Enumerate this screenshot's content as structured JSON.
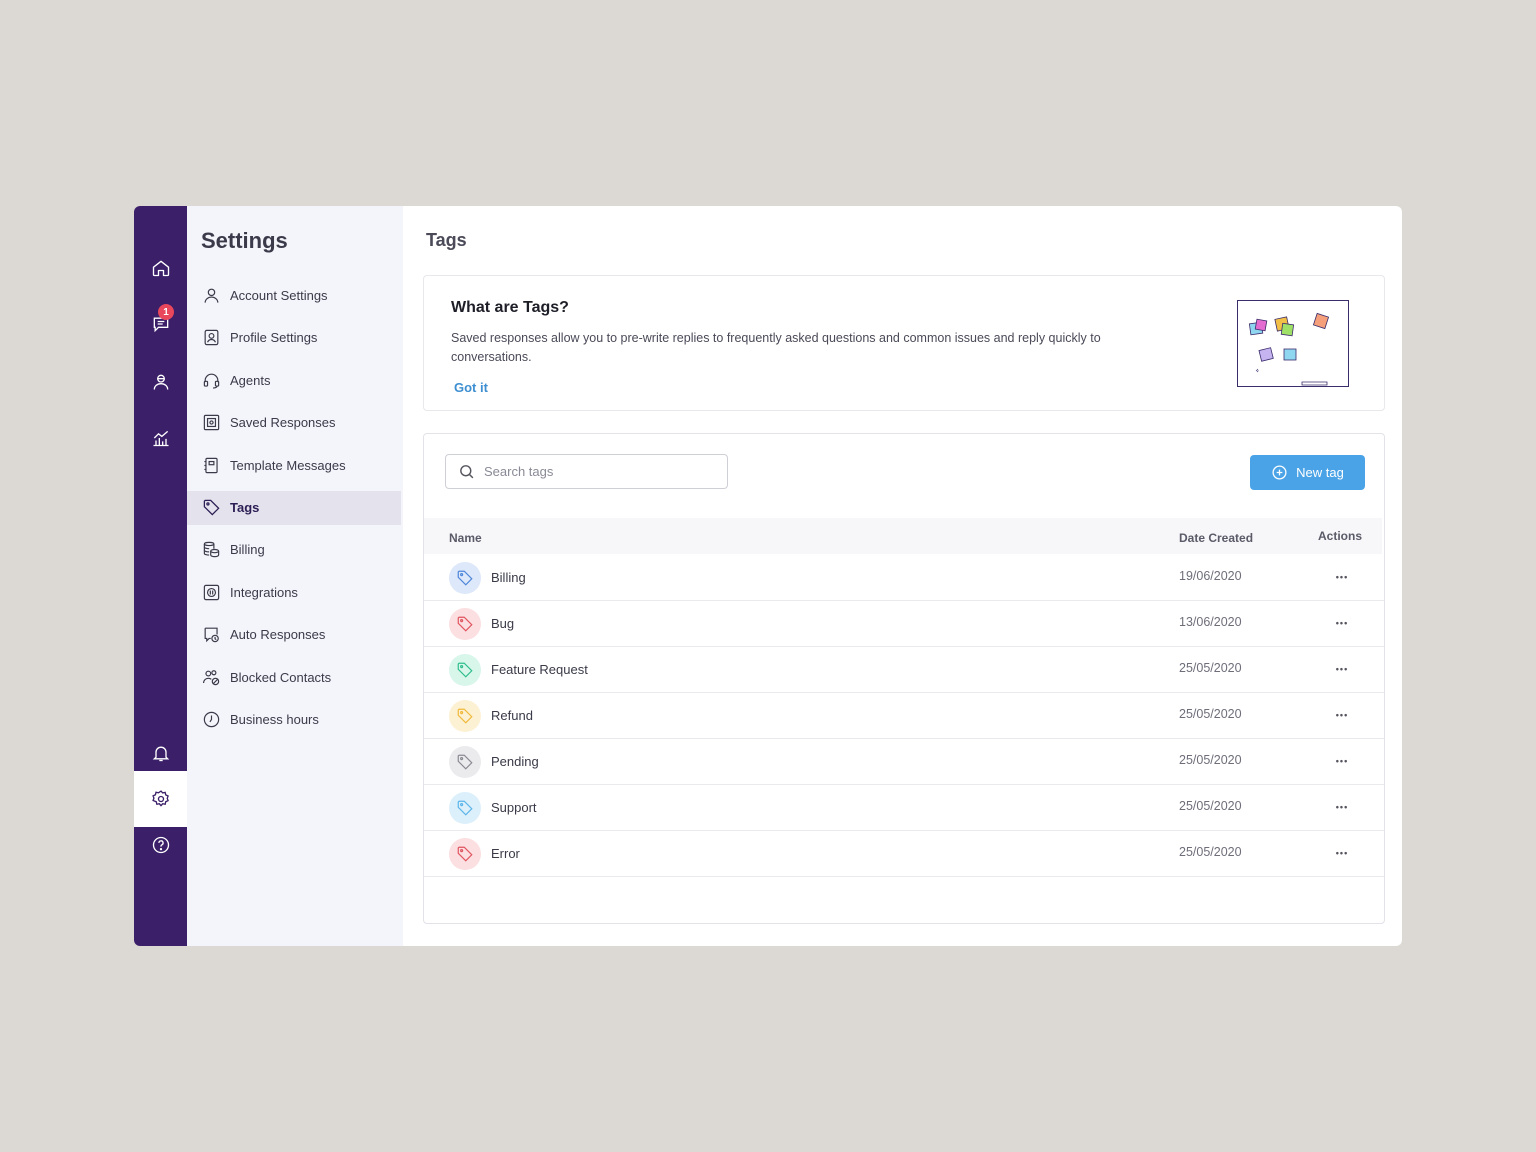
{
  "rail": {
    "badge_count": "1",
    "items": [
      "home-icon",
      "chat-icon",
      "agents-icon",
      "analytics-icon",
      "bell-icon",
      "gear-icon",
      "help-icon"
    ]
  },
  "sidebar": {
    "title": "Settings",
    "items": [
      {
        "label": "Account Settings",
        "icon": "user-icon"
      },
      {
        "label": "Profile Settings",
        "icon": "profile-card-icon"
      },
      {
        "label": "Agents",
        "icon": "headset-icon"
      },
      {
        "label": "Saved Responses",
        "icon": "saved-responses-icon"
      },
      {
        "label": "Template Messages",
        "icon": "template-icon"
      },
      {
        "label": "Tags",
        "icon": "tag-icon",
        "active": true
      },
      {
        "label": "Billing",
        "icon": "coins-icon"
      },
      {
        "label": "Integrations",
        "icon": "integrations-icon"
      },
      {
        "label": "Auto Responses",
        "icon": "auto-response-icon"
      },
      {
        "label": "Blocked Contacts",
        "icon": "blocked-contacts-icon"
      },
      {
        "label": "Business hours",
        "icon": "clock-icon"
      }
    ]
  },
  "main": {
    "title": "Tags",
    "info": {
      "title": "What are Tags?",
      "text": "Saved responses allow you to pre-write replies to frequently asked questions and common issues and reply quickly to conversations.",
      "link": "Got it"
    },
    "search": {
      "placeholder": "Search tags"
    },
    "new_button": "New tag",
    "table": {
      "headers": {
        "name": "Name",
        "date": "Date Created",
        "actions": "Actions"
      },
      "rows": [
        {
          "name": "Billing",
          "date": "19/06/2020",
          "color": "#4f86d9",
          "bg": "#dde8fa"
        },
        {
          "name": "Bug",
          "date": "13/06/2020",
          "color": "#e0545f",
          "bg": "#fbdfe1"
        },
        {
          "name": "Feature Request",
          "date": "25/05/2020",
          "color": "#2fbf8d",
          "bg": "#d9f6eb"
        },
        {
          "name": "Refund",
          "date": "25/05/2020",
          "color": "#f0b93a",
          "bg": "#fdf1d4"
        },
        {
          "name": "Pending",
          "date": "25/05/2020",
          "color": "#8a8a92",
          "bg": "#ebebee"
        },
        {
          "name": "Support",
          "date": "25/05/2020",
          "color": "#5bb4ea",
          "bg": "#dcf0fb"
        },
        {
          "name": "Error",
          "date": "25/05/2020",
          "color": "#e0545f",
          "bg": "#fbdfe1"
        }
      ]
    }
  }
}
